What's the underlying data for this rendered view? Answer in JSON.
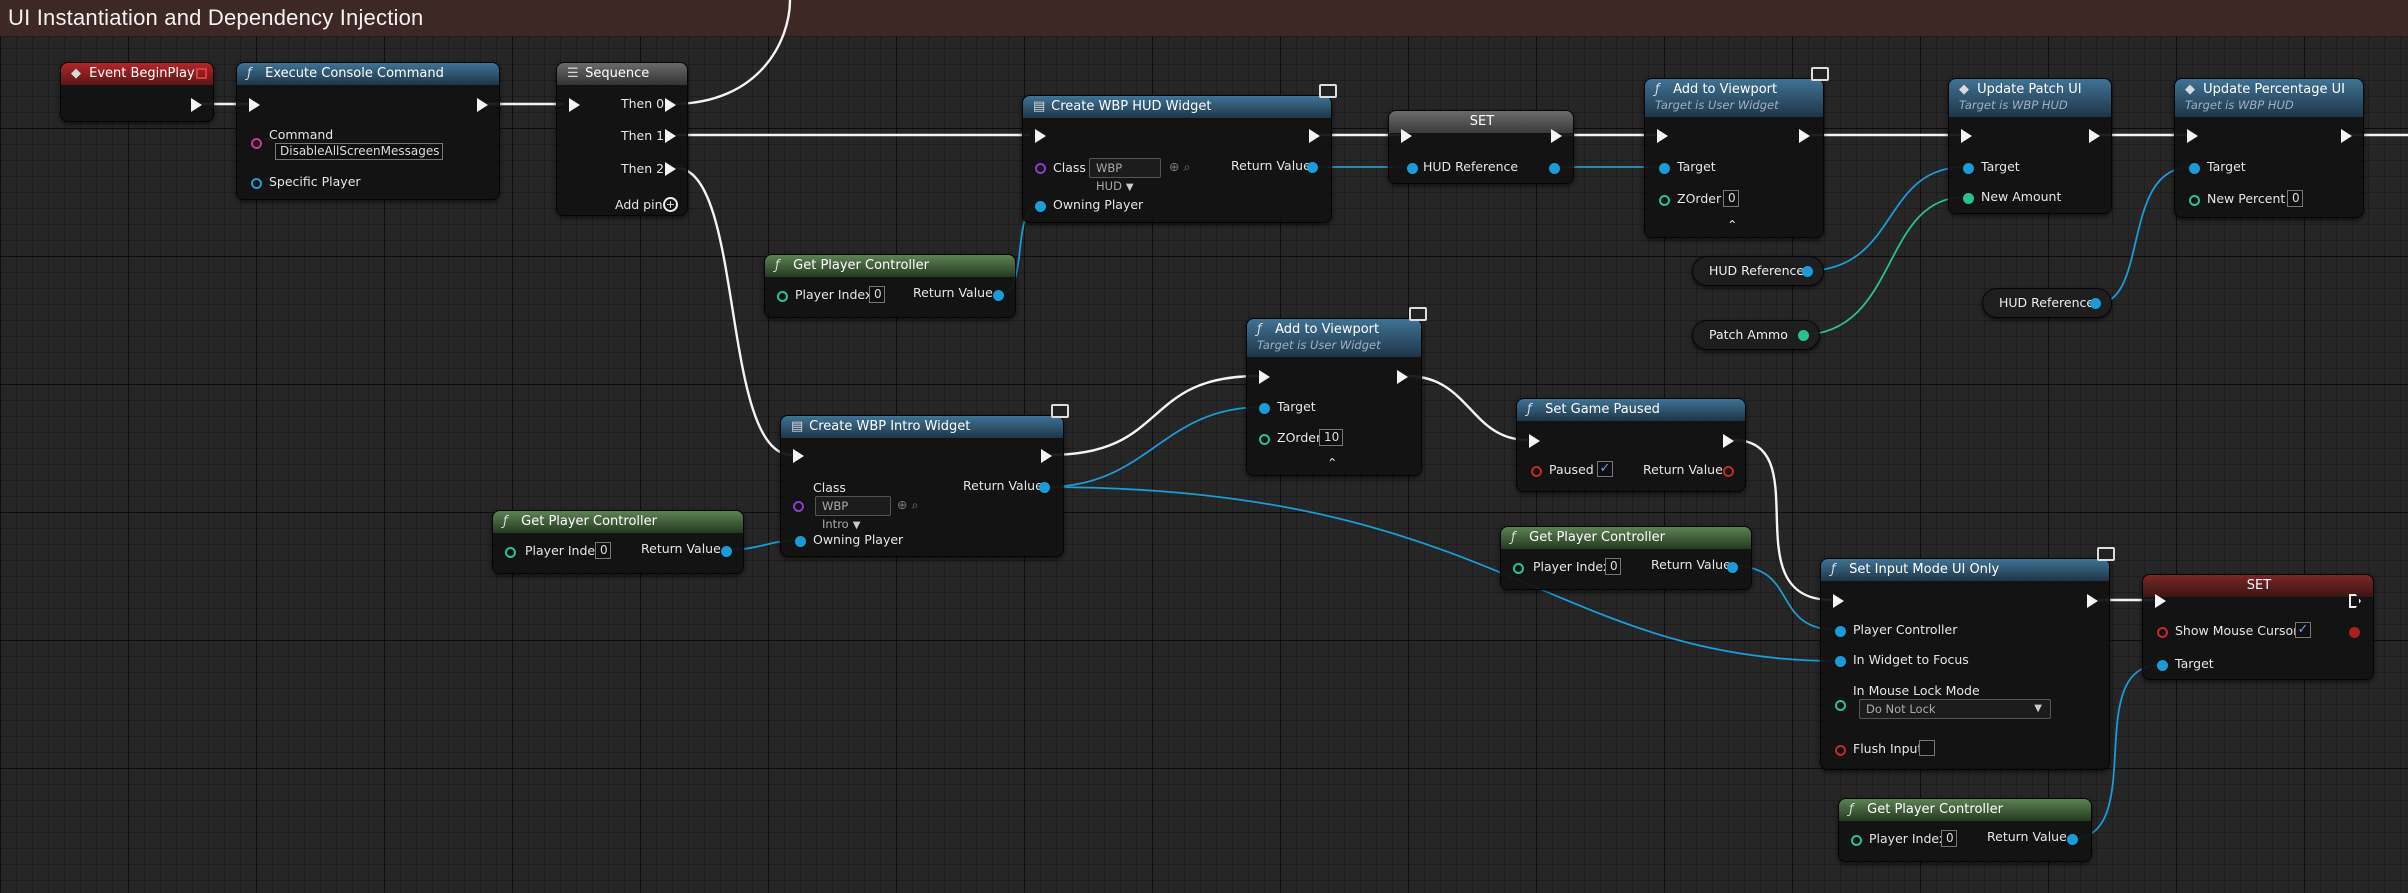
{
  "comment": {
    "title": "UI Instantiation and Dependency Injection"
  },
  "nodes": {
    "begin_play": {
      "title": "Event BeginPlay"
    },
    "console_cmd": {
      "title": "Execute Console Command",
      "command_label": "Command",
      "command_value": "DisableAllScreenMessages",
      "specific_player": "Specific Player"
    },
    "sequence": {
      "title": "Sequence",
      "then0": "Then 0",
      "then1": "Then 1",
      "then2": "Then 2",
      "add_pin": "Add pin"
    },
    "create_hud": {
      "title": "Create WBP HUD Widget",
      "class_label": "Class",
      "class_value": "WBP HUD",
      "return_value": "Return Value",
      "owning_player": "Owning Player"
    },
    "set_hud": {
      "title": "SET",
      "hud_reference": "HUD Reference"
    },
    "add_vp_hud": {
      "title": "Add to Viewport",
      "subtitle": "Target is User Widget",
      "target": "Target",
      "zorder": "ZOrder",
      "zorder_value": "0"
    },
    "update_patch": {
      "title": "Update Patch UI",
      "subtitle": "Target is WBP HUD",
      "target": "Target",
      "new_amount": "New Amount"
    },
    "update_percent": {
      "title": "Update Percentage UI",
      "subtitle": "Target is WBP HUD",
      "target": "Target",
      "new_percent": "New Percent",
      "new_percent_value": "0"
    },
    "gpc_hud": {
      "title": "Get Player Controller",
      "player_index": "Player Index",
      "player_index_value": "0",
      "return_value": "Return Value"
    },
    "var_hud_ref_1": {
      "label": "HUD Reference"
    },
    "var_patch_ammo": {
      "label": "Patch Ammo"
    },
    "var_hud_ref_2": {
      "label": "HUD Reference"
    },
    "add_vp_intro": {
      "title": "Add to Viewport",
      "subtitle": "Target is User Widget",
      "target": "Target",
      "zorder": "ZOrder",
      "zorder_value": "10"
    },
    "create_intro": {
      "title": "Create WBP Intro Widget",
      "class_label": "Class",
      "class_value": "WBP Intro",
      "return_value": "Return Value",
      "owning_player": "Owning Player"
    },
    "set_paused": {
      "title": "Set Game Paused",
      "paused": "Paused",
      "return_value": "Return Value"
    },
    "gpc_intro": {
      "title": "Get Player Controller",
      "player_index": "Player Index",
      "player_index_value": "0",
      "return_value": "Return Value"
    },
    "gpc_input": {
      "title": "Get Player Controller",
      "player_index": "Player Index",
      "player_index_value": "0",
      "return_value": "Return Value"
    },
    "set_input": {
      "title": "Set Input Mode UI Only",
      "player_controller": "Player Controller",
      "widget_focus": "In Widget to Focus",
      "mouse_lock": "In Mouse Lock Mode",
      "mouse_lock_value": "Do Not Lock",
      "flush_input": "Flush Input"
    },
    "set_cursor": {
      "title": "SET",
      "show_cursor": "Show Mouse Cursor",
      "target": "Target"
    },
    "gpc_cursor": {
      "title": "Get Player Controller",
      "player_index": "Player Index",
      "player_index_value": "0",
      "return_value": "Return Value"
    }
  },
  "colors": {
    "exec_wire": "#f4f4f4",
    "object_wire": "#1b9bd7",
    "int_wire": "#2ac289",
    "bool_wire": "#c02b2b"
  }
}
